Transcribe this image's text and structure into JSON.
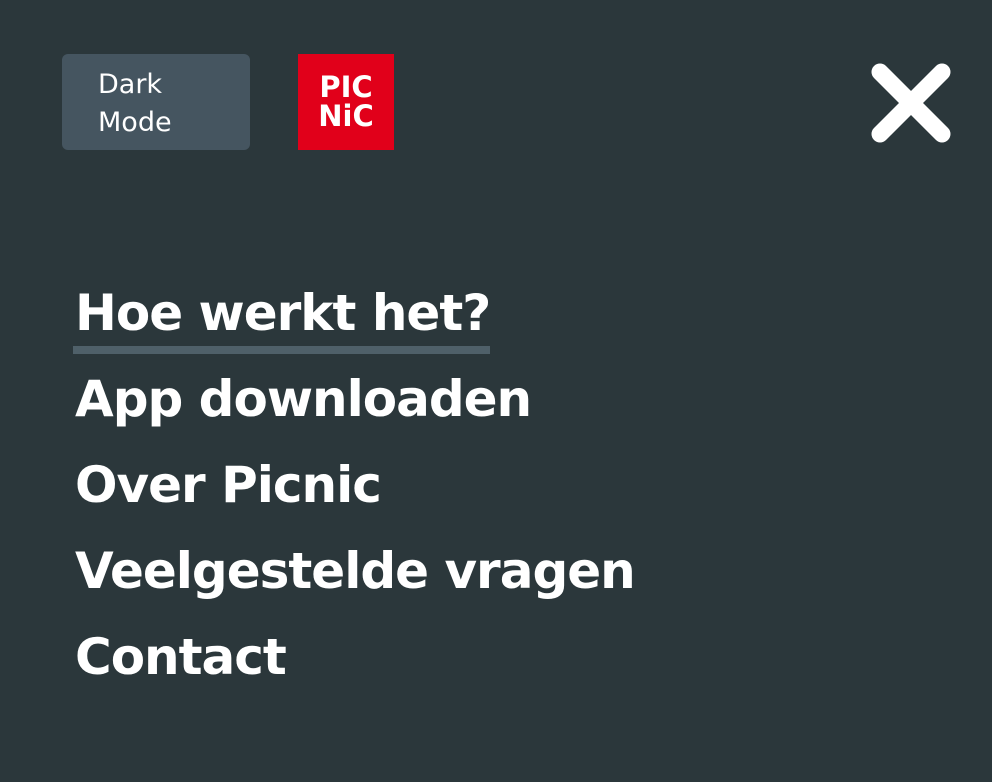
{
  "header": {
    "dark_mode_label_line1": "Dark",
    "dark_mode_label_line2": "Mode",
    "logo_line1": "PIC",
    "logo_line2": "NiC",
    "close_icon": "close-icon"
  },
  "nav": {
    "items": [
      {
        "label": "Hoe werkt het?",
        "active": true
      },
      {
        "label": "App downloaden",
        "active": false
      },
      {
        "label": "Over Picnic",
        "active": false
      },
      {
        "label": "Veelgestelde vragen",
        "active": false
      },
      {
        "label": "Contact",
        "active": false
      }
    ]
  },
  "colors": {
    "background": "#2b373b",
    "button_bg": "#455560",
    "brand_red": "#e1001a",
    "underline": "#4f6069",
    "text": "#ffffff"
  }
}
